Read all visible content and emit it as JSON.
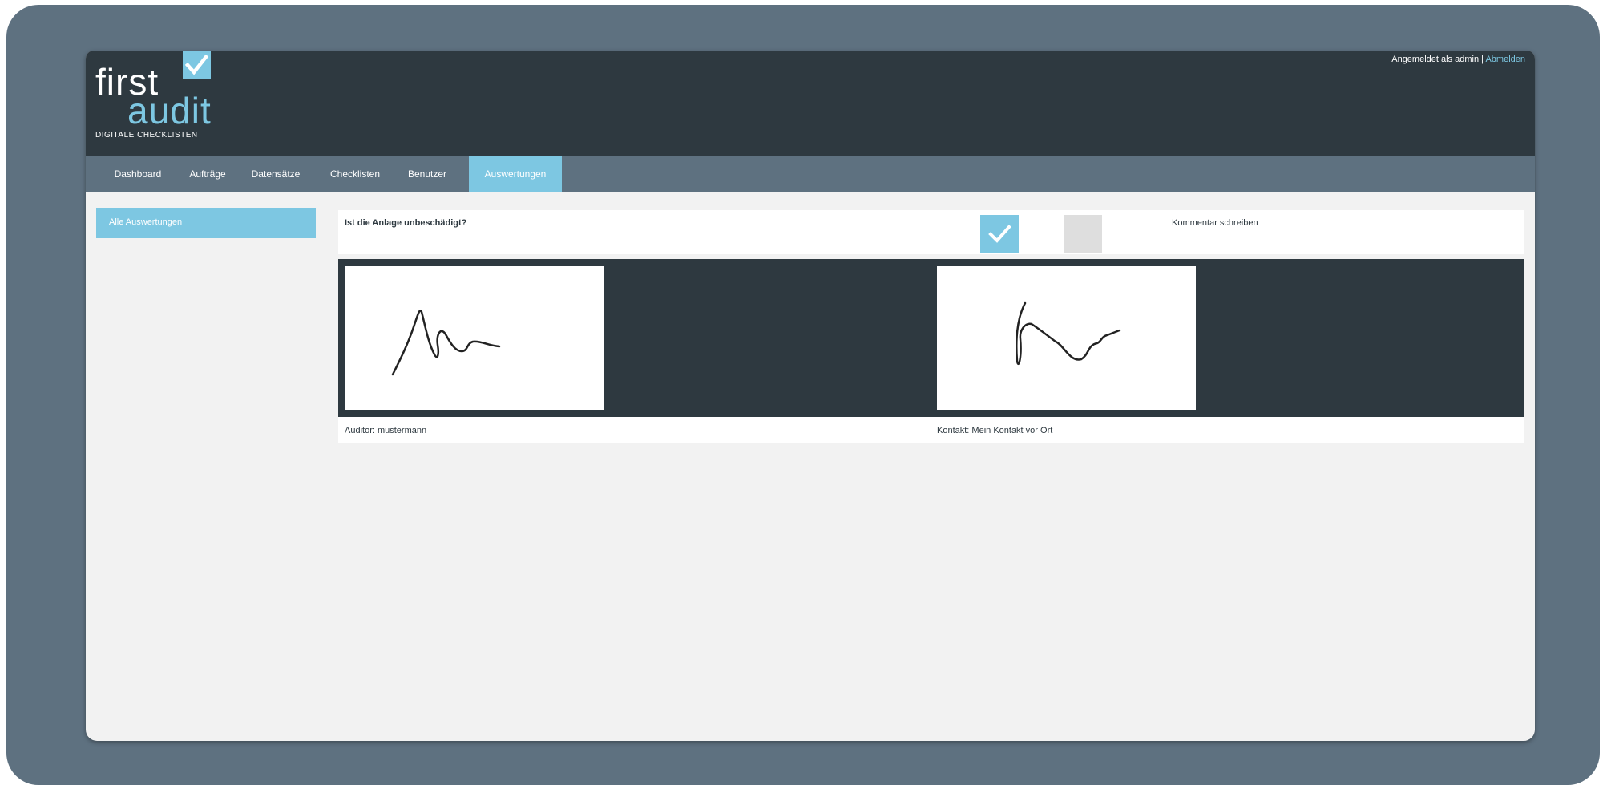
{
  "branding": {
    "logo_first": "first",
    "logo_audit": "audit",
    "tagline": "DIGITALE CHECKLISTEN",
    "accent_color": "#7dc7e2",
    "dark_color": "#2e3940",
    "nav_color": "#5e7180"
  },
  "userbar": {
    "logged_in_text": "Angemeldet als admin |",
    "logout_label": "Abmelden"
  },
  "nav": {
    "items": [
      {
        "label": "Dashboard"
      },
      {
        "label": "Aufträge"
      },
      {
        "label": "Datensätze"
      },
      {
        "label": "Checklisten"
      },
      {
        "label": "Benutzer"
      },
      {
        "label": "Auswertungen",
        "active": true
      }
    ]
  },
  "sidebar": {
    "items": [
      {
        "label": "Alle Auswertungen"
      }
    ]
  },
  "question": {
    "text": "Ist die Anlage unbeschädigt?",
    "answer": "yes",
    "comment_label": "Kommentar schreiben"
  },
  "signatures": {
    "auditor_caption": "Auditor: mustermann",
    "contact_caption": "Kontakt: Mein Kontakt vor Ort"
  }
}
